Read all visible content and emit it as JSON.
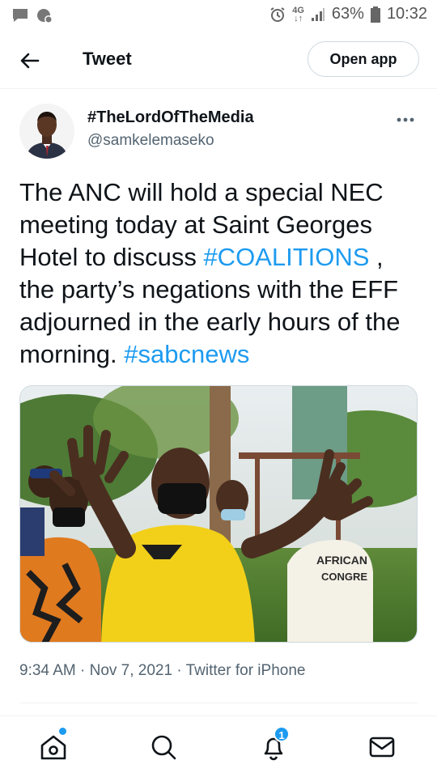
{
  "status_bar": {
    "network_top": "4G",
    "network_bottom": "↓↑",
    "battery": "63%",
    "time": "10:32"
  },
  "header": {
    "title": "Tweet",
    "open_app_label": "Open app"
  },
  "tweet": {
    "display_name": "#TheLordOfTheMedia",
    "handle": "@samkelemaseko",
    "text_parts": [
      "The ANC will hold a special NEC meeting today at Saint Georges Hotel to discuss ",
      "#COALITIONS",
      " , the party’s negations with the EFF adjourned in the early hours of the morning. ",
      "#sabcnews"
    ],
    "time": "9:34 AM",
    "date": "Nov 7, 2021",
    "source": "Twitter for iPhone",
    "separator": "·"
  },
  "media": {
    "sign_line1": "AFRICAN",
    "sign_line2": "CONGRE"
  },
  "tabbar": {
    "notifications_count": "1"
  },
  "colors": {
    "accent": "#1d9bf0",
    "text": "#0f1419",
    "muted": "#536471",
    "border": "#cfd9de"
  },
  "icons": {
    "back": "arrow-left-icon",
    "more": "more-horizontal-icon",
    "home": "home-icon",
    "search": "search-icon",
    "notifications": "bell-icon",
    "messages": "envelope-icon"
  }
}
